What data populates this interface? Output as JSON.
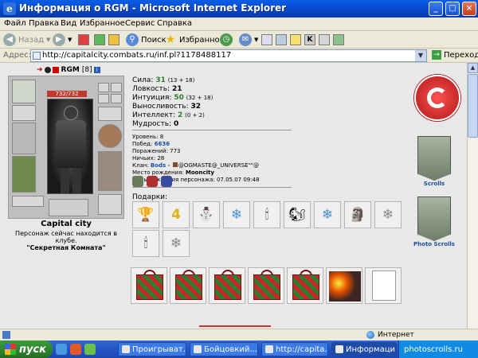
{
  "window": {
    "title": "Информация о RGM - Microsoft Internet Explorer",
    "controls": {
      "minimize": "_",
      "maximize": "□",
      "close": "×"
    }
  },
  "menu": [
    "Файл",
    "Правка",
    "Вид",
    "Избранное",
    "Сервис",
    "Справка"
  ],
  "toolbar": {
    "back": "Назад",
    "search": "Поиск",
    "favorites": "Избранное"
  },
  "address": {
    "label": "Адрес:",
    "url": "http://capitalcity.combats.ru/inf.pl?1178488117",
    "go": "Переход"
  },
  "profile": {
    "nick": "RGM",
    "level_tag": "[8]",
    "hp": "732/732",
    "stats": [
      {
        "label": "Сила:",
        "value": "31",
        "bonus": "(13 + 18)"
      },
      {
        "label": "Ловкость:",
        "value": "21",
        "bonus": ""
      },
      {
        "label": "Интуиция:",
        "value": "50",
        "bonus": "(32 + 18)"
      },
      {
        "label": "Выносливость:",
        "value": "32",
        "bonus": ""
      },
      {
        "label": "Интеллект:",
        "value": "2",
        "bonus": "(0 + 2)"
      },
      {
        "label": "Мудрость:",
        "value": "0",
        "bonus": ""
      }
    ],
    "details": {
      "level": "Уровень: 8",
      "wins_label": "Побед:",
      "wins": "6636",
      "losses": "Поражений: 773",
      "draws": "Ничьих: 28",
      "clan_label": "Клан:",
      "clan": "Bods -",
      "clan_rest": "@OGMASTE@_UNIVERSE\"\"@",
      "birthplace_label": "Место рождения:",
      "birthplace": "Mooncity",
      "birthday": "День рождения персонажа: 07.05.07 09:48"
    },
    "location": {
      "city": "Capital city",
      "where": "Персонаж сейчас находится в клубе.",
      "room": "\"Секретная Комната\""
    },
    "gifts_label": "Подарки:",
    "gifts_row1": [
      "🏆",
      "4",
      "⛄",
      "❄",
      "🕯",
      "🐿",
      "❄",
      "🗿",
      "❄"
    ],
    "gifts_row2": [
      "🕯",
      "❄"
    ],
    "scrolls_label": "Scrolls",
    "photo_scrolls_label": "Photo Scrolls"
  },
  "status": {
    "zone": "Интернет"
  },
  "taskbar": {
    "start": "пуск",
    "tasks": [
      "Проигрыват...",
      "Бойцовкий...",
      "http://capita...",
      "Информаци..."
    ],
    "tray": "photoscrolls.ru"
  }
}
